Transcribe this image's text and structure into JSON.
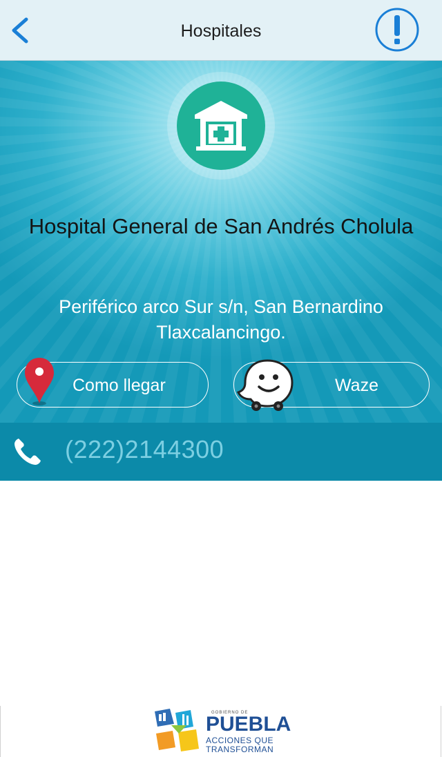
{
  "nav": {
    "title": "Hospitales",
    "back_icon": "chevron-left-icon",
    "alert_icon": "exclamation-circle-icon"
  },
  "hospital": {
    "icon": "hospital-building-icon",
    "name": "Hospital General de San Andrés Cholula",
    "address": "Periférico arco Sur s/n, San Bernardino Tlaxcalancingo."
  },
  "actions": {
    "como_llegar_label": "Como llegar",
    "waze_label": "Waze",
    "pin_icon": "map-pin-icon",
    "waze_icon": "waze-icon"
  },
  "phone": {
    "number": "(222)2144300",
    "icon": "phone-icon"
  },
  "footer": {
    "logo_small": "GOBIERNO DE",
    "logo_name": "PUEBLA",
    "logo_tag_1": "ACCIONES QUE",
    "logo_tag_2": "TRANSFORMAN"
  },
  "colors": {
    "accent": "#1a7fd6",
    "hero": "#2eb0cc",
    "icon_green": "#1fb297",
    "phone_bar": "#0c8aa9",
    "pin_red": "#d62a3b"
  }
}
